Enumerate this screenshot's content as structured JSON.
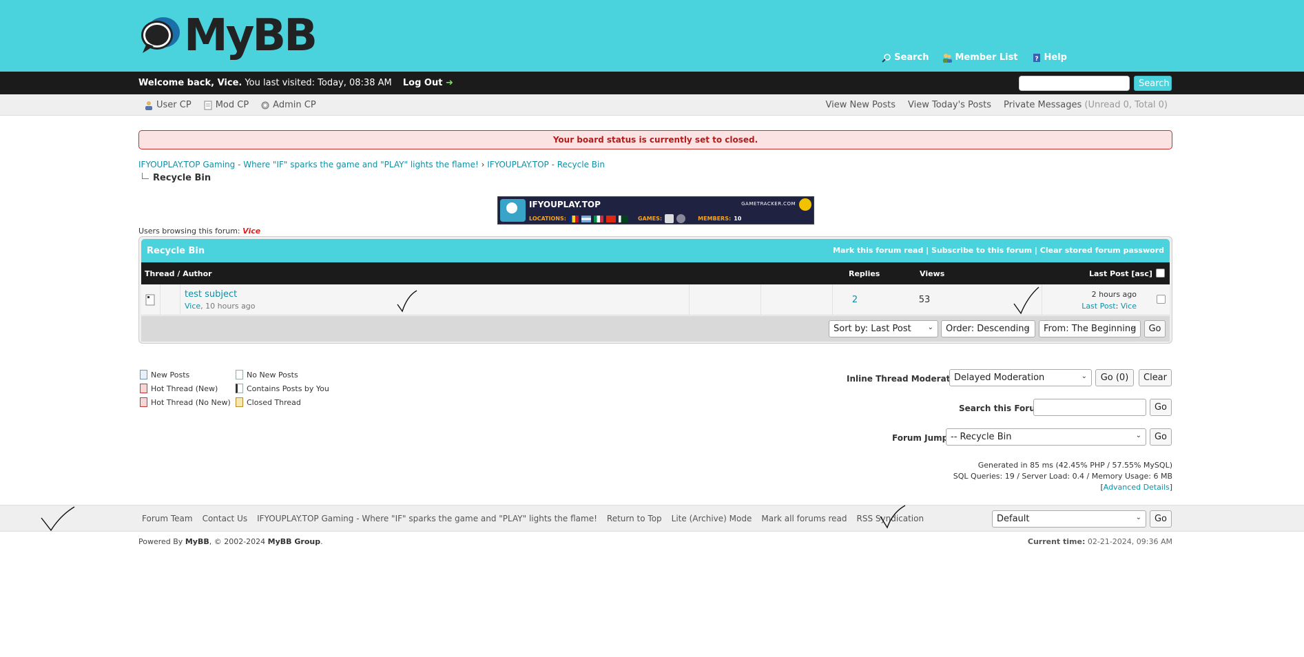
{
  "header": {
    "logo_text": "MyBB",
    "links": [
      {
        "label": "Search",
        "icon": "magnifier-icon"
      },
      {
        "label": "Member List",
        "icon": "members-icon"
      },
      {
        "label": "Help",
        "icon": "help-book-icon"
      }
    ]
  },
  "welcome": {
    "greeting": "Welcome back, Vice.",
    "last_visit": "You last visited: Today, 08:38 AM",
    "logout": "Log Out",
    "search_button": "Search",
    "search_placeholder": ""
  },
  "panel": {
    "left": [
      "User CP",
      "Mod CP",
      "Admin CP"
    ],
    "view_new": "View New Posts",
    "view_today": "View Today's Posts",
    "pm": "Private Messages",
    "pm_counts": "(Unread 0, Total 0)"
  },
  "status_msg": "Your board status is currently set to closed.",
  "breadcrumb": {
    "root": "IFYOUPLAY.TOP Gaming - Where \"IF\" sparks the game and \"PLAY\" lights the flame!",
    "sep": "›",
    "parent": "IFYOUPLAY.TOP - Recycle Bin",
    "current": "Recycle Bin"
  },
  "banner": {
    "server_name": "IFYOUPLAY.TOP",
    "brand": "GAMETRACKER.COM",
    "locations_label": "LOCATIONS:",
    "games_label": "GAMES:",
    "members_label": "MEMBERS:",
    "members_value": "10"
  },
  "browsing": {
    "label": "Users browsing this forum:",
    "user": "Vice"
  },
  "forum": {
    "title": "Recycle Bin",
    "link_mark_read": "Mark this forum read",
    "link_subscribe": "Subscribe to this forum",
    "link_clear_pw": "Clear stored forum password",
    "link_sep": "|",
    "col_thread": "Thread / Author",
    "col_replies": "Replies",
    "col_views": "Views",
    "col_lastpost": "Last Post [asc]",
    "thread": {
      "subject": "test subject",
      "author": "Vice",
      "started": ", 10 hours ago",
      "replies": "2",
      "views": "53",
      "last_time": "2 hours ago",
      "last_label": "Last Post",
      "last_sep": ":",
      "last_by": "Vice"
    },
    "sort_by": "Sort by: Last Post",
    "order": "Order: Descending",
    "from": "From: The Beginning",
    "go": "Go"
  },
  "legend": {
    "new_posts": "New Posts",
    "no_new_posts": "No New Posts",
    "hot_new": "Hot Thread (New)",
    "contains_yours": "Contains Posts by You",
    "hot_no_new": "Hot Thread (No New)",
    "closed": "Closed Thread"
  },
  "moderation": {
    "label": "Inline Thread Moderation:",
    "value": "Delayed Moderation",
    "go": "Go (0)",
    "clear": "Clear"
  },
  "forum_search": {
    "label": "Search this Forum:",
    "go": "Go"
  },
  "forum_jump": {
    "label": "Forum Jump:",
    "value": "-- Recycle Bin",
    "go": "Go"
  },
  "debug": {
    "line1": "Generated in 85 ms (42.45% PHP / 57.55% MySQL)",
    "line2": "SQL Queries: 19 / Server Load: 0.4 / Memory Usage: 6 MB",
    "advanced": "Advanced Details"
  },
  "footer": {
    "links": [
      "Forum Team",
      "Contact Us",
      "IFYOUPLAY.TOP Gaming - Where \"IF\" sparks the game and \"PLAY\" lights the flame!",
      "Return to Top",
      "Lite (Archive) Mode",
      "Mark all forums read",
      "RSS Syndication"
    ],
    "theme": "Default",
    "go": "Go"
  },
  "copyright": {
    "prefix": "Powered By",
    "mybb": "MyBB",
    "mid": ", © 2002-2024",
    "group": "MyBB Group",
    "end": "."
  },
  "current_time": {
    "label": "Current time:",
    "value": "02-21-2024, 09:36 AM"
  },
  "colors": {
    "accent": "#4ad3dc",
    "dark_bar": "#1b1b1b",
    "status_red": "#b11c1c"
  }
}
